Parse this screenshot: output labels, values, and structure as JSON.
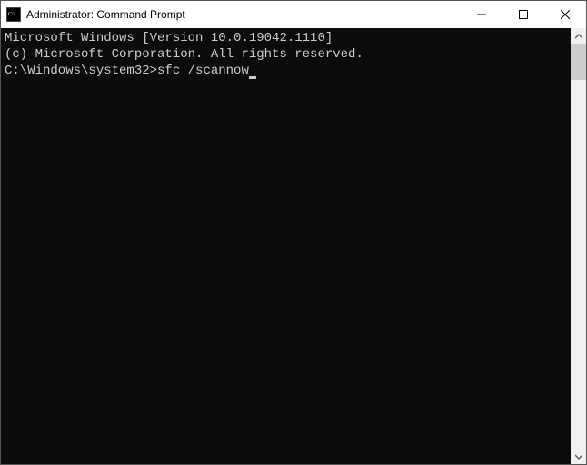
{
  "titlebar": {
    "title": "Administrator: Command Prompt",
    "icon": "cmd-icon"
  },
  "terminal": {
    "line1": "Microsoft Windows [Version 10.0.19042.1110]",
    "line2": "(c) Microsoft Corporation. All rights reserved.",
    "blank": "",
    "prompt": "C:\\Windows\\system32>",
    "command": "sfc /scannow"
  }
}
